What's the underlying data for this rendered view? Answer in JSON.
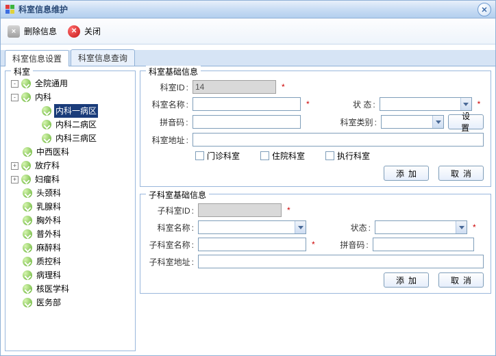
{
  "window": {
    "title": "科室信息维护"
  },
  "toolbar": {
    "delete": "删除信息",
    "close": "关闭"
  },
  "tabs": [
    {
      "label": "科室信息设置",
      "active": true
    },
    {
      "label": "科室信息查询",
      "active": false
    }
  ],
  "tree": {
    "legend": "科室",
    "nodes": [
      {
        "label": "全院通用",
        "indent": 0,
        "toggle": "-",
        "sel": false
      },
      {
        "label": "内科",
        "indent": 0,
        "toggle": "-",
        "sel": false
      },
      {
        "label": "内科一病区",
        "indent": 2,
        "toggle": "",
        "sel": true
      },
      {
        "label": "内科二病区",
        "indent": 2,
        "toggle": "",
        "sel": false
      },
      {
        "label": "内科三病区",
        "indent": 2,
        "toggle": "",
        "sel": false
      },
      {
        "label": "中西医科",
        "indent": 0,
        "toggle": "",
        "sel": false
      },
      {
        "label": "放疗科",
        "indent": 0,
        "toggle": "+",
        "sel": false
      },
      {
        "label": "妇瘤科",
        "indent": 0,
        "toggle": "+",
        "sel": false
      },
      {
        "label": "头颈科",
        "indent": 0,
        "toggle": "",
        "sel": false
      },
      {
        "label": "乳腺科",
        "indent": 0,
        "toggle": "",
        "sel": false
      },
      {
        "label": "胸外科",
        "indent": 0,
        "toggle": "",
        "sel": false
      },
      {
        "label": "普外科",
        "indent": 0,
        "toggle": "",
        "sel": false
      },
      {
        "label": "麻醉科",
        "indent": 0,
        "toggle": "",
        "sel": false
      },
      {
        "label": "质控科",
        "indent": 0,
        "toggle": "",
        "sel": false
      },
      {
        "label": "病理科",
        "indent": 0,
        "toggle": "",
        "sel": false
      },
      {
        "label": "核医学科",
        "indent": 0,
        "toggle": "",
        "sel": false
      },
      {
        "label": "医务部",
        "indent": 0,
        "toggle": "",
        "sel": false
      }
    ]
  },
  "basic": {
    "legend": "科室基础信息",
    "id_label": "科室ID",
    "id_value": "14",
    "name_label": "科室名称",
    "status_label": "状  态",
    "pinyin_label": "拼音码",
    "type_label": "科室类别",
    "type_btn": "设置",
    "addr_label": "科室地址",
    "chk_outpatient": "门诊科室",
    "chk_inpatient": "住院科室",
    "chk_exec": "执行科室",
    "btn_add": "添加",
    "btn_cancel": "取消"
  },
  "sub": {
    "legend": "子科室基础信息",
    "id_label": "子科室ID",
    "name_label": "科室名称",
    "status_label": "状态",
    "subname_label": "子科室名称",
    "pinyin_label": "拼音码",
    "addr_label": "子科室地址",
    "btn_add": "添加",
    "btn_cancel": "取消"
  }
}
